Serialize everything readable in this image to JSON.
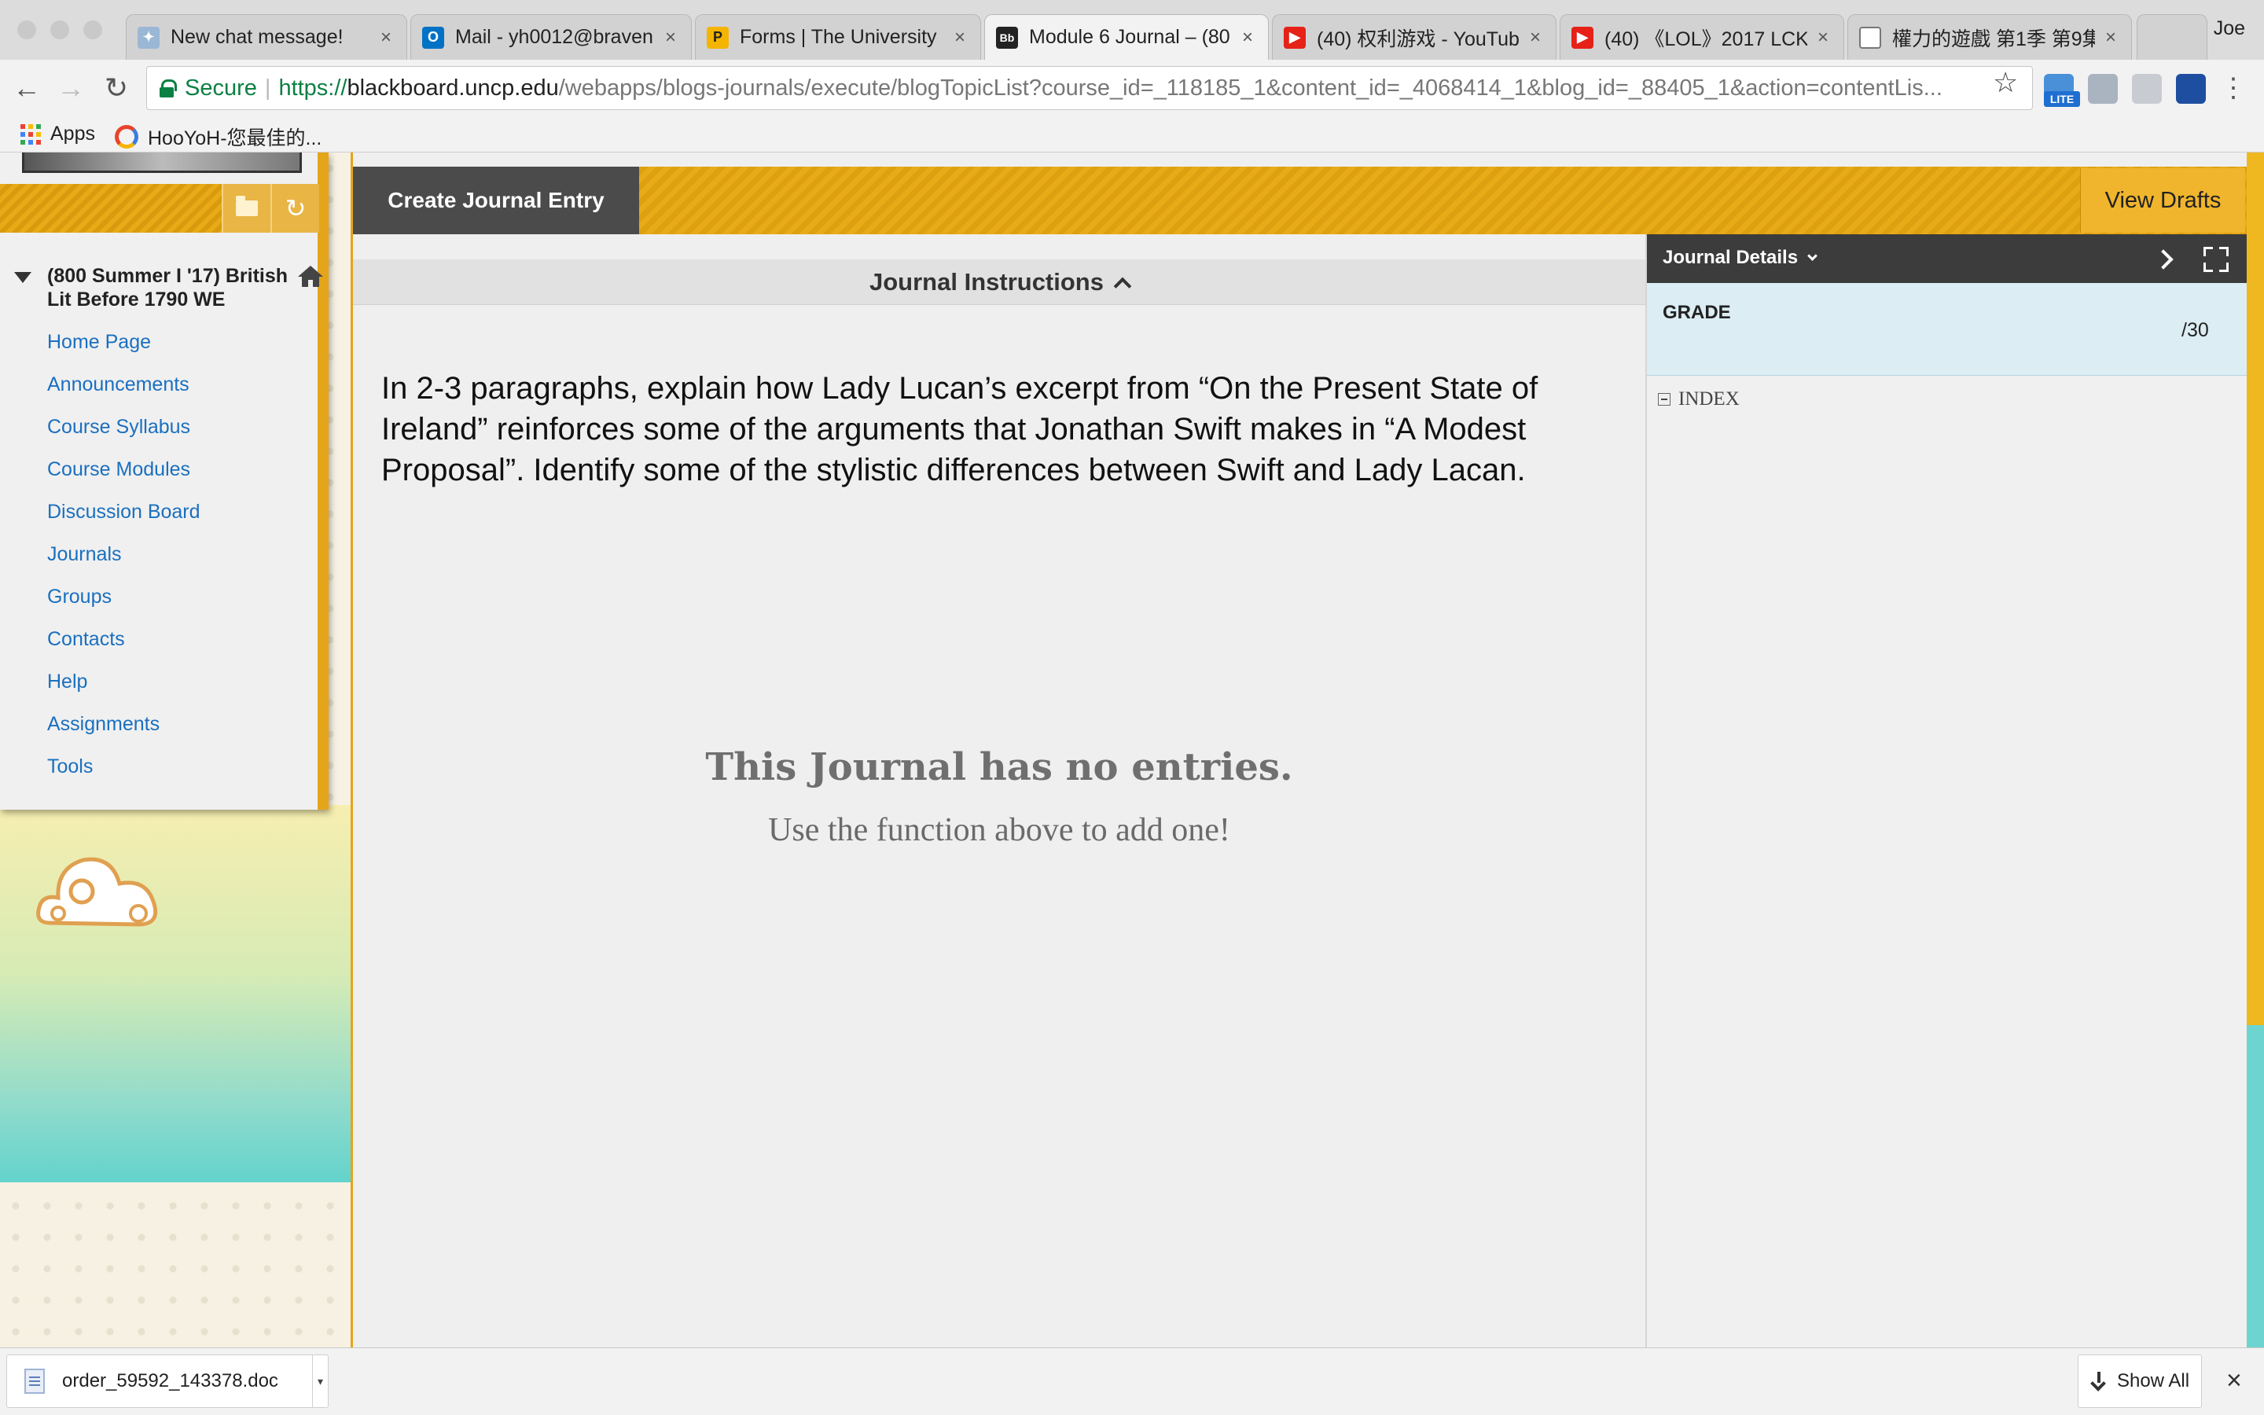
{
  "browser": {
    "tabs": [
      {
        "label": "New chat message!",
        "favicon": "chat-icon",
        "active": false
      },
      {
        "label": "Mail - yh0012@braven",
        "favicon": "outlook-icon",
        "active": false
      },
      {
        "label": "Forms | The University",
        "favicon": "p-logo-icon",
        "active": false
      },
      {
        "label": "Module 6 Journal – (80",
        "favicon": "blackboard-icon",
        "active": true
      },
      {
        "label": "(40) 权利游戏 - YouTub",
        "favicon": "youtube-icon",
        "active": false
      },
      {
        "label": "(40) 《LOL》2017 LCK",
        "favicon": "youtube-icon",
        "active": false
      },
      {
        "label": "權力的遊戲 第1季 第9集",
        "favicon": "page-icon",
        "active": false
      }
    ],
    "tab_close_glyph": "×",
    "profile_name": "Joe",
    "security_label": "Secure",
    "url": {
      "scheme": "https://",
      "host": "blackboard.uncp.edu",
      "path": "/webapps/blogs-journals/execute/blogTopicList?course_id=_118185_1&content_id=_4068414_1&blog_id=_88405_1&action=contentLis..."
    },
    "bookmarks": [
      {
        "label": "Apps",
        "icon": "apps-grid-icon"
      },
      {
        "label": "HooYoH-您最佳的...",
        "icon": "hooyoh-icon"
      }
    ],
    "extensions": {
      "lite_badge": "LITE"
    }
  },
  "course_menu": {
    "course_title": "(800 Summer I '17) British Lit Before 1790 WE",
    "links": [
      "Home Page",
      "Announcements",
      "Course Syllabus",
      "Course Modules",
      "Discussion Board",
      "Journals",
      "Groups",
      "Contacts",
      "Help",
      "Assignments",
      "Tools"
    ],
    "link_color": "#1a6fc0"
  },
  "journal": {
    "create_entry_label": "Create Journal Entry",
    "view_drafts_label": "View Drafts",
    "instructions_heading": "Journal Instructions",
    "instructions_text": "In 2-3 paragraphs, explain how Lady Lucan’s excerpt from “On the Present State of Ireland” reinforces some of the arguments that Jonathan Swift makes in “A Modest Proposal”.  Identify some of the stylistic differences between Swift and Lady Lacan.",
    "empty_title": "This Journal has no entries.",
    "empty_subtitle": "Use the function above to add one!"
  },
  "details_panel": {
    "title": "Journal Details",
    "grade_label": "GRADE",
    "grade_value": "/30",
    "index_label": "INDEX"
  },
  "download_shelf": {
    "file_name": "order_59592_143378.doc",
    "show_all_label": "Show All",
    "close_glyph": "×"
  },
  "colors": {
    "accent_gold": "#e8ab17",
    "dark_button": "#4b4b4b",
    "secure_green": "#0b8043",
    "grade_bg": "#dcedf4"
  }
}
